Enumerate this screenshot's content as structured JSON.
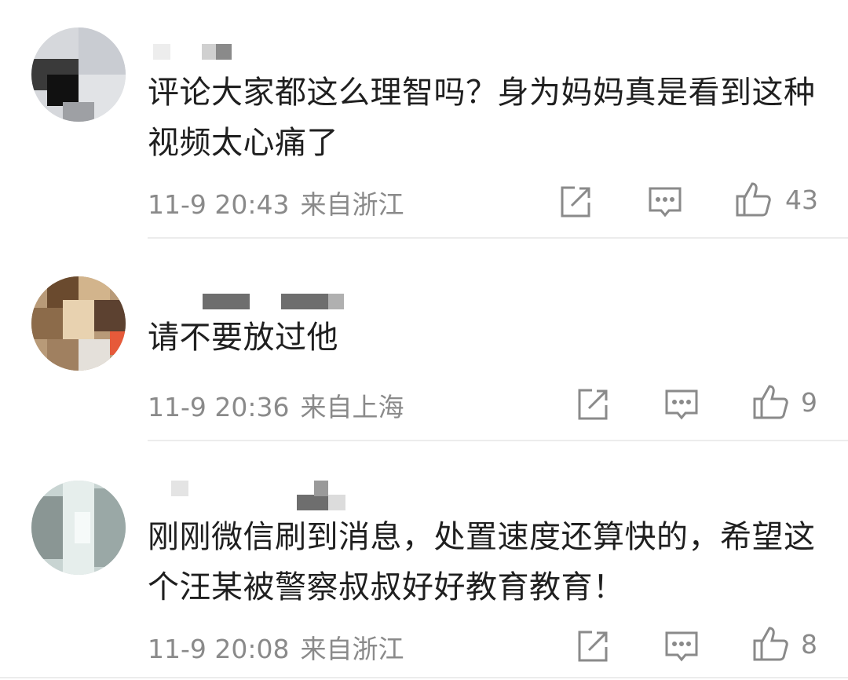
{
  "comments": [
    {
      "text": "评论大家都这么理智吗？身为妈妈真是看到这种视频太心痛了",
      "time": "11-9 20:43",
      "location": "来自浙江",
      "likes": "43"
    },
    {
      "text": "请不要放过他",
      "time": "11-9 20:36",
      "location": "来自上海",
      "likes": "9"
    },
    {
      "text": "刚刚微信刷到消息，处置速度还算快的，希望这个汪某被警察叔叔好好教育教育！",
      "time": "11-9 20:08",
      "location": "来自浙江",
      "likes": "8"
    }
  ],
  "icons": {
    "share": "share-icon",
    "reply": "comment-icon",
    "like": "thumbs-up-icon"
  },
  "colors": {
    "text": "#1f1f1f",
    "meta": "#8a8a8a",
    "divider": "#ececec"
  }
}
